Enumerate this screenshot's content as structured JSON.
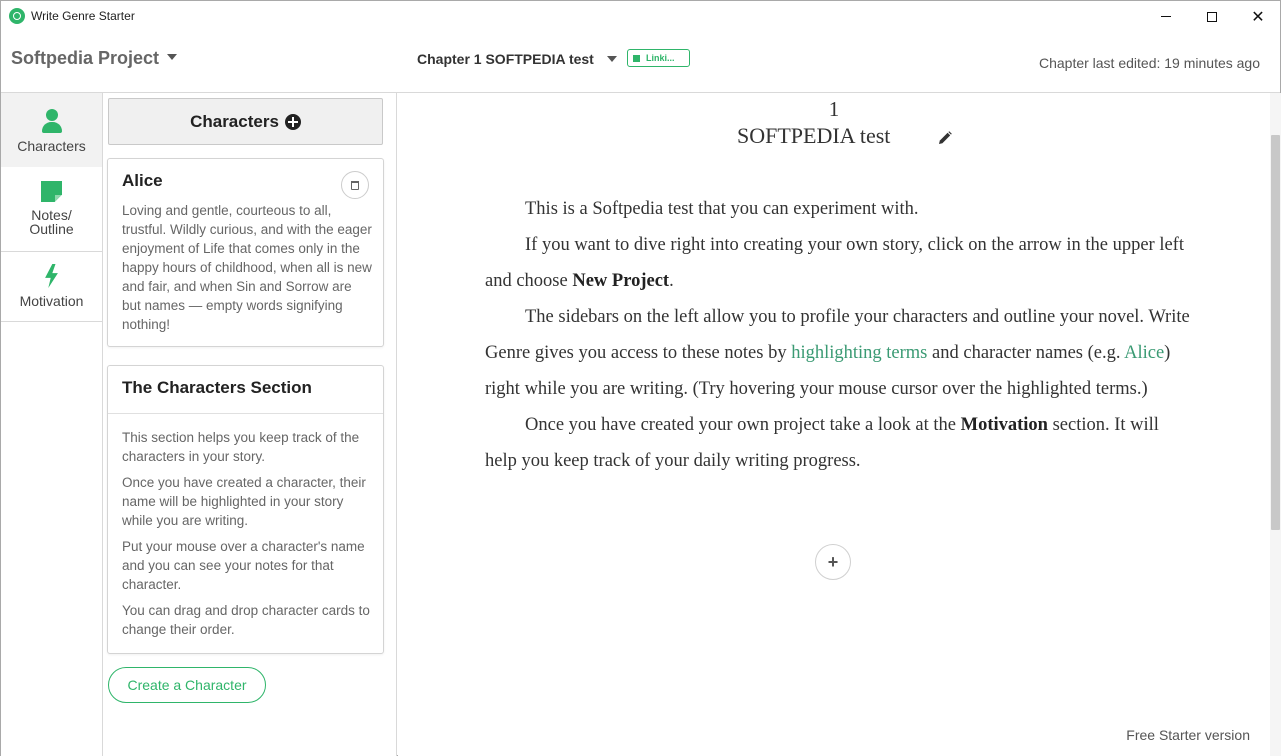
{
  "window": {
    "title": "Write Genre Starter",
    "controls": {
      "minimize": "minimize",
      "maximize": "maximize",
      "close": "✕"
    }
  },
  "header": {
    "project_name": "Softpedia Project",
    "chapter_name": "Chapter 1 SOFTPEDIA test",
    "link_badge": "Linki...",
    "last_edited": "Chapter last edited: 19 minutes ago"
  },
  "nav": {
    "items": [
      {
        "label": "Characters",
        "icon": "person-icon",
        "active": true
      },
      {
        "label": "Notes/ Outline",
        "icon": "note-icon",
        "active": false
      },
      {
        "label": "Motivation",
        "icon": "bolt-icon",
        "active": false
      }
    ]
  },
  "characters": {
    "header": "Characters",
    "cards": [
      {
        "name": "Alice",
        "description": "Loving and gentle, courteous to all, trustful. Wildly curious, and with the eager enjoyment of Life that comes only in the happy hours of childhood, when all is new and fair, and when Sin and Sorrow are but names — empty words signifying nothing!"
      }
    ],
    "section": {
      "title": "The Characters Section",
      "paragraphs": [
        "This section helps you keep track of the characters in your story.",
        "Once you have created a character, their name will be highlighted in your story while you are writing.",
        "Put your mouse over a character's name and you can see your notes for that character.",
        "You can drag and drop character cards to change their order."
      ]
    },
    "create_button": "Create a Character"
  },
  "editor": {
    "chapter_number": "1",
    "chapter_title": "SOFTPEDIA test",
    "p1": "This is a Softpedia test that you can experiment with.",
    "p2_a": "If you want to dive right into creating your own story, click on the arrow in the upper left and choose ",
    "p2_bold": "New Project",
    "p2_b": ".",
    "p3_a": "The sidebars on the left allow you to profile your characters and outline your novel. Write Genre gives you access to these notes by ",
    "p3_hl1": "highlighting terms",
    "p3_b": " and character names (e.g. ",
    "p3_hl2": "Alice",
    "p3_c": ") right while you are writing. (Try hovering your mouse cursor over the highlighted terms.)",
    "p4_a": "Once you have created your own project take a look at the ",
    "p4_bold": "Motivation",
    "p4_b": " section. It will help you keep track of your daily writing progress.",
    "add_button": "+",
    "version": "Free Starter version"
  },
  "colors": {
    "accent": "#2fb56a",
    "highlight": "#3a9a73"
  }
}
